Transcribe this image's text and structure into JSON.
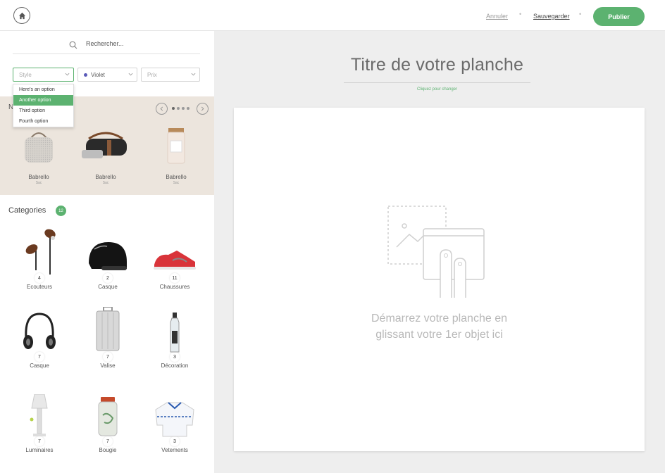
{
  "header": {
    "cancel_label": "Annuler",
    "separator": "•",
    "save_label": "Sauvegarder",
    "publish_label": "Publier"
  },
  "sidebar": {
    "search": {
      "placeholder": "Rechercher..."
    },
    "filters": {
      "style": "Style",
      "color": "Violet",
      "price": "Prix"
    },
    "style_options": [
      "Here's an option",
      "Another option",
      "Third option",
      "Fourth option"
    ],
    "style_options_active_index": 1,
    "featured": {
      "title": "N",
      "items": [
        {
          "name": "Babrello",
          "sub": "Sac"
        },
        {
          "name": "Babrello",
          "sub": "Sac"
        },
        {
          "name": "Babrello",
          "sub": "Sac"
        }
      ]
    },
    "categories": {
      "title": "Categories",
      "count": "12",
      "items": [
        {
          "name": "Ecouteurs",
          "count": "4",
          "icon": "earphones-icon"
        },
        {
          "name": "Casque",
          "count": "2",
          "icon": "helmet-icon"
        },
        {
          "name": "Chaussures",
          "count": "11",
          "icon": "sneaker-icon"
        },
        {
          "name": "Casque",
          "count": "7",
          "icon": "headphones-icon"
        },
        {
          "name": "Valise",
          "count": "7",
          "icon": "suitcase-icon"
        },
        {
          "name": "Décoration",
          "count": "3",
          "icon": "bottle-icon"
        },
        {
          "name": "Luminaires",
          "count": "7",
          "icon": "lamp-icon"
        },
        {
          "name": "Bougie",
          "count": "7",
          "icon": "jar-icon"
        },
        {
          "name": "Vetements",
          "count": "3",
          "icon": "sweater-icon"
        }
      ]
    }
  },
  "main": {
    "board_title": "Titre de votre planche",
    "title_hint": "Cliquez pour changer",
    "drop_line1": "Démarrez votre planche en",
    "drop_line2": "glissant votre 1er objet ici"
  },
  "colors": {
    "accent": "#5cb270",
    "featured_bg": "#ece5dd",
    "main_bg": "#eeeeee",
    "violet": "#5a5ab8"
  }
}
